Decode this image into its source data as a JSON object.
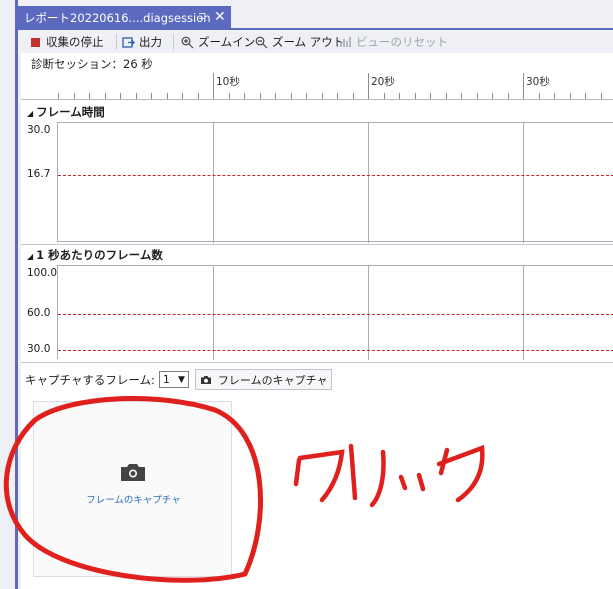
{
  "tab": {
    "title": "レポート20220616....diagsession",
    "pin": "⊐",
    "close": "✕"
  },
  "toolbar": {
    "stop_label": "収集の停止",
    "output_label": "出力",
    "zoom_in_label": "ズームイン",
    "zoom_out_label": "ズーム アウト",
    "reset_view_label": "ビューのリセット"
  },
  "session": {
    "label": "診断セッション：26 秒"
  },
  "ruler": {
    "labels": [
      "10秒",
      "20秒",
      "30秒"
    ]
  },
  "frame_time": {
    "title": "フレーム時間",
    "y_labels": [
      "30.0",
      "16.7"
    ]
  },
  "fps": {
    "title": "1 秒あたりのフレーム数",
    "y_labels": [
      "100.0",
      "60.0",
      "30.0"
    ]
  },
  "capture": {
    "label": "キャプチャするフレーム:",
    "selected": "1",
    "button_label": "フレームのキャプチャ"
  },
  "card": {
    "label": "フレームのキャプチャ"
  },
  "annotation": {
    "text": "クリック",
    "color": "#e0201c"
  },
  "colors": {
    "accent": "#5b6abf",
    "guide": "#c0272d",
    "link": "#2a6fba"
  }
}
